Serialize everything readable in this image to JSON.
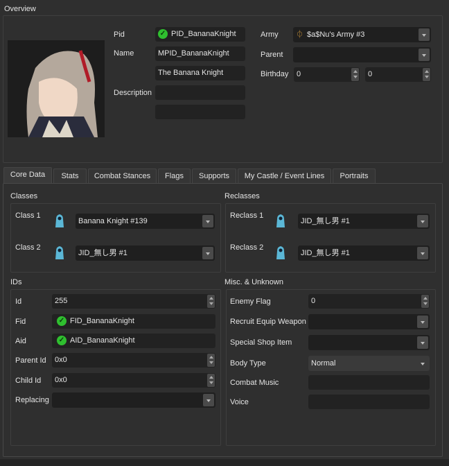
{
  "overview": {
    "title": "Overview",
    "pid_label": "Pid",
    "pid": "PID_BananaKnight",
    "name_label": "Name",
    "name": "MPID_BananaKnight",
    "display_name": "The Banana Knight",
    "description_label": "Description",
    "description1": "",
    "description2": "",
    "army_label": "Army",
    "army": "$a$Nu's Army #3",
    "parent_label": "Parent",
    "parent": "",
    "birthday_label": "Birthday",
    "birthday_month": "0",
    "birthday_day": "0"
  },
  "tabs": [
    "Core Data",
    "Stats",
    "Combat Stances",
    "Flags",
    "Supports",
    "My Castle / Event Lines",
    "Portraits"
  ],
  "classes": {
    "title": "Classes",
    "class1_label": "Class 1",
    "class1": "Banana Knight #139",
    "class2_label": "Class 2",
    "class2": "JID_無し男 #1"
  },
  "reclasses": {
    "title": "Reclasses",
    "reclass1_label": "Reclass 1",
    "reclass1": "JID_無し男 #1",
    "reclass2_label": "Reclass 2",
    "reclass2": "JID_無し男 #1"
  },
  "ids": {
    "title": "IDs",
    "id_label": "Id",
    "id": "255",
    "fid_label": "Fid",
    "fid": "FID_BananaKnight",
    "aid_label": "Aid",
    "aid": "AID_BananaKnight",
    "parent_id_label": "Parent Id",
    "parent_id": "0x0",
    "child_id_label": "Child Id",
    "child_id": "0x0",
    "replacing_label": "Replacing",
    "replacing": ""
  },
  "misc": {
    "title": "Misc. & Unknown",
    "enemy_flag_label": "Enemy Flag",
    "enemy_flag": "0",
    "recruit_label": "Recruit Equip Weapon",
    "recruit": "",
    "shop_label": "Special Shop Item",
    "shop": "",
    "body_label": "Body Type",
    "body": "Normal",
    "music_label": "Combat Music",
    "music": "",
    "voice_label": "Voice",
    "voice": ""
  }
}
